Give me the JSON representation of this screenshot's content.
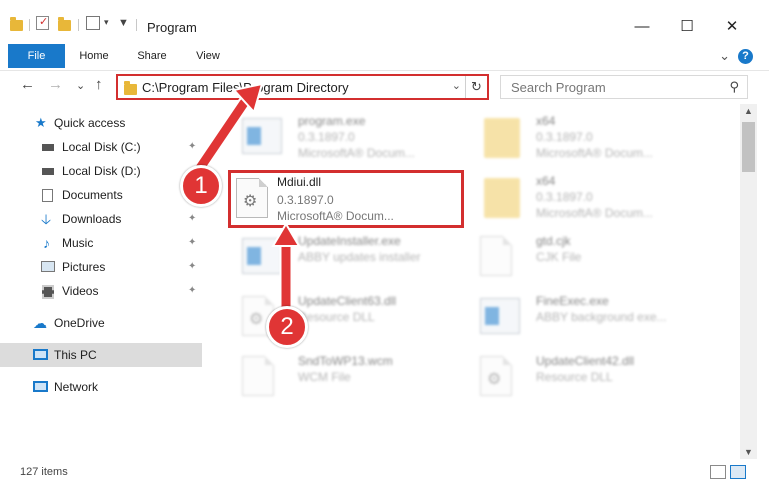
{
  "window": {
    "title": "Program",
    "minimize": "—",
    "maximize": "☐",
    "close": "✕"
  },
  "ribbon": {
    "tabs": [
      "File",
      "Home",
      "Share",
      "View"
    ],
    "collapse": "⌄",
    "help": "?"
  },
  "nav": {
    "back": "←",
    "forward": "→",
    "recent": "⌄",
    "up": "↑",
    "address": "C:\\Program Files\\Program Directory",
    "address_dropdown": "⌄",
    "refresh": "↻",
    "search_placeholder": "Search Program"
  },
  "sidebar": {
    "items": [
      {
        "label": "Quick access",
        "icon": "star-icon",
        "pinned": false
      },
      {
        "label": "Local Disk (C:)",
        "icon": "drive-icon",
        "pinned": true
      },
      {
        "label": "Local Disk (D:)",
        "icon": "drive-icon",
        "pinned": false
      },
      {
        "label": "Documents",
        "icon": "documents-icon",
        "pinned": true
      },
      {
        "label": "Downloads",
        "icon": "download-icon",
        "pinned": true
      },
      {
        "label": "Music",
        "icon": "music-icon",
        "pinned": true
      },
      {
        "label": "Pictures",
        "icon": "pictures-icon",
        "pinned": true
      },
      {
        "label": "Videos",
        "icon": "video-icon",
        "pinned": true
      },
      {
        "label": "OneDrive",
        "icon": "cloud-icon",
        "pinned": false
      },
      {
        "label": "This PC",
        "icon": "computer-icon",
        "pinned": false,
        "selected": true
      },
      {
        "label": "Network",
        "icon": "network-icon",
        "pinned": false
      }
    ],
    "pin_glyph": "📌"
  },
  "files": [
    {
      "name": "program.exe",
      "line2": "0.3.1897.0",
      "line3": "MicrosoftA® Docum...",
      "icon": "exe-icon",
      "highlight": false
    },
    {
      "name": "x64",
      "line2": "0.3.1897.0",
      "line3": "MicrosoftA® Docum...",
      "icon": "folder-icon",
      "highlight": false
    },
    {
      "name": "Mdiui.dll",
      "line2": "0.3.1897.0",
      "line3": "MicrosoftA® Docum...",
      "icon": "dll-icon",
      "highlight": true
    },
    {
      "name": "x64",
      "line2": "0.3.1897.0",
      "line3": "MicrosoftA® Docum...",
      "icon": "folder-icon",
      "highlight": false
    },
    {
      "name": "UpdateInstaller.exe",
      "line2": "ABBY updates installer",
      "line3": "",
      "icon": "exe-icon",
      "highlight": false
    },
    {
      "name": "gtd.cjk",
      "line2": "CJK File",
      "line3": "",
      "icon": "file-icon",
      "highlight": false
    },
    {
      "name": "UpdateClient63.dll",
      "line2": "Resource DLL",
      "line3": "",
      "icon": "dll-icon",
      "highlight": false
    },
    {
      "name": "FineExec.exe",
      "line2": "ABBY background exe...",
      "line3": "",
      "icon": "exe-icon",
      "highlight": false
    },
    {
      "name": "SndToWP13.wcm",
      "line2": "WCM File",
      "line3": "",
      "icon": "file-icon",
      "highlight": false
    },
    {
      "name": "UpdateClient42.dll",
      "line2": "Resource DLL",
      "line3": "",
      "icon": "dll-icon",
      "highlight": false
    }
  ],
  "status": {
    "item_count": "127 items"
  },
  "annotations": {
    "step1": "1",
    "step2": "2"
  },
  "colors": {
    "accent": "#1979ca",
    "annotation_red": "#e03535",
    "folder": "#e8b739"
  }
}
